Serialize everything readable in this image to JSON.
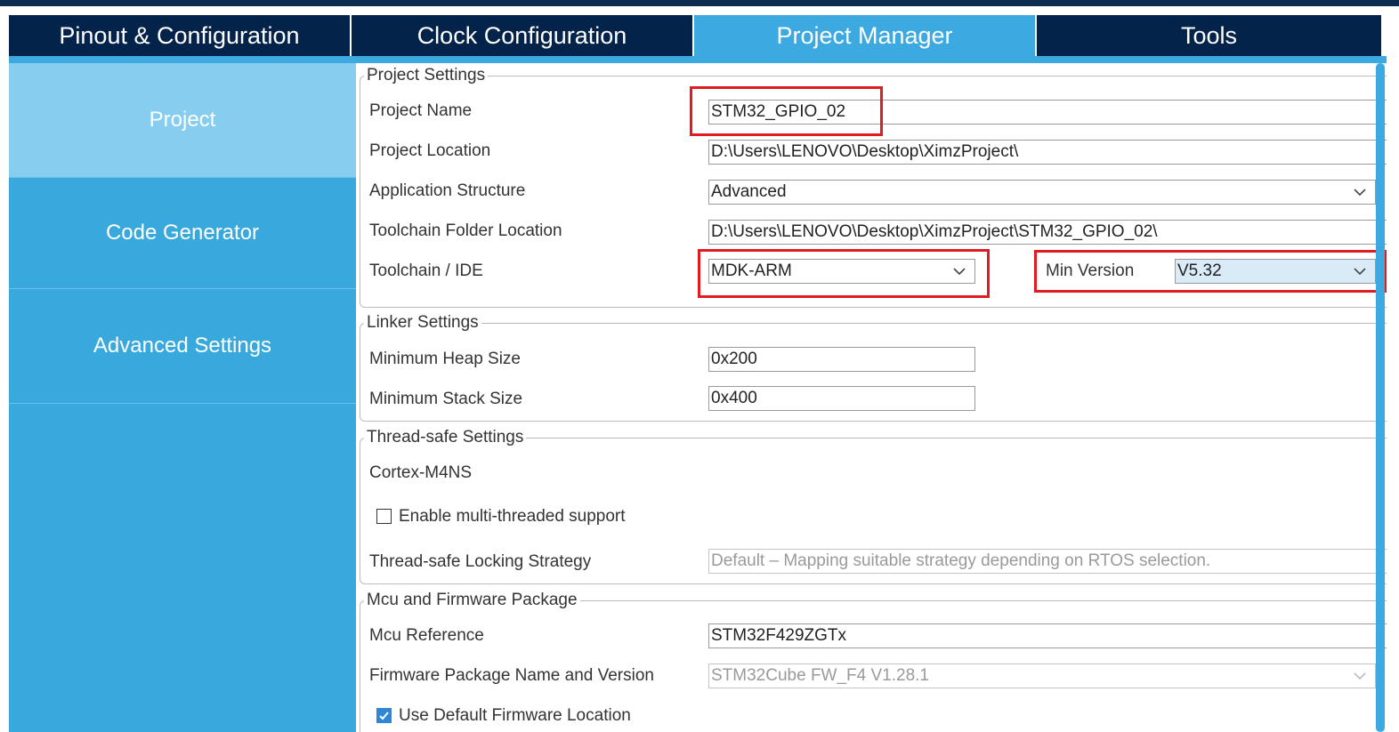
{
  "tabs": [
    {
      "label": "Pinout & Configuration",
      "active": false
    },
    {
      "label": "Clock Configuration",
      "active": false
    },
    {
      "label": "Project Manager",
      "active": true
    },
    {
      "label": "Tools",
      "active": false
    }
  ],
  "sidebar": {
    "items": [
      {
        "label": "Project",
        "active": true
      },
      {
        "label": "Code Generator",
        "active": false
      },
      {
        "label": "Advanced Settings",
        "active": false
      }
    ]
  },
  "project_settings": {
    "legend": "Project Settings",
    "project_name_label": "Project Name",
    "project_name_value": "STM32_GPIO_02",
    "project_location_label": "Project Location",
    "project_location_value": "D:\\Users\\LENOVO\\Desktop\\XimzProject\\",
    "app_structure_label": "Application Structure",
    "app_structure_value": "Advanced",
    "toolchain_folder_label": "Toolchain Folder Location",
    "toolchain_folder_value": "D:\\Users\\LENOVO\\Desktop\\XimzProject\\STM32_GPIO_02\\",
    "toolchain_ide_label": "Toolchain / IDE",
    "toolchain_ide_value": "MDK-ARM",
    "min_version_label": "Min Version",
    "min_version_value": "V5.32"
  },
  "linker_settings": {
    "legend": "Linker Settings",
    "heap_label": "Minimum Heap Size",
    "heap_value": "0x200",
    "stack_label": "Minimum Stack Size",
    "stack_value": "0x400"
  },
  "thread_safe": {
    "legend": "Thread-safe Settings",
    "core": "Cortex-M4NS",
    "multithread_label": "Enable multi-threaded support",
    "multithread_checked": false,
    "locking_label": "Thread-safe Locking Strategy",
    "locking_value": "Default  –  Mapping suitable strategy depending on RTOS selection."
  },
  "mcu_firmware": {
    "legend": "Mcu and Firmware Package",
    "mcu_ref_label": "Mcu Reference",
    "mcu_ref_value": "STM32F429ZGTx",
    "fw_label": "Firmware Package Name and Version",
    "fw_value": "STM32Cube FW_F4 V1.28.1",
    "default_fw_label": "Use Default Firmware Location",
    "default_fw_checked": true
  },
  "colors": {
    "tab_dark": "#03234b",
    "accent_blue": "#3ca9e0",
    "sidebar_active": "#86cdef",
    "highlight_red": "#e01b22"
  }
}
